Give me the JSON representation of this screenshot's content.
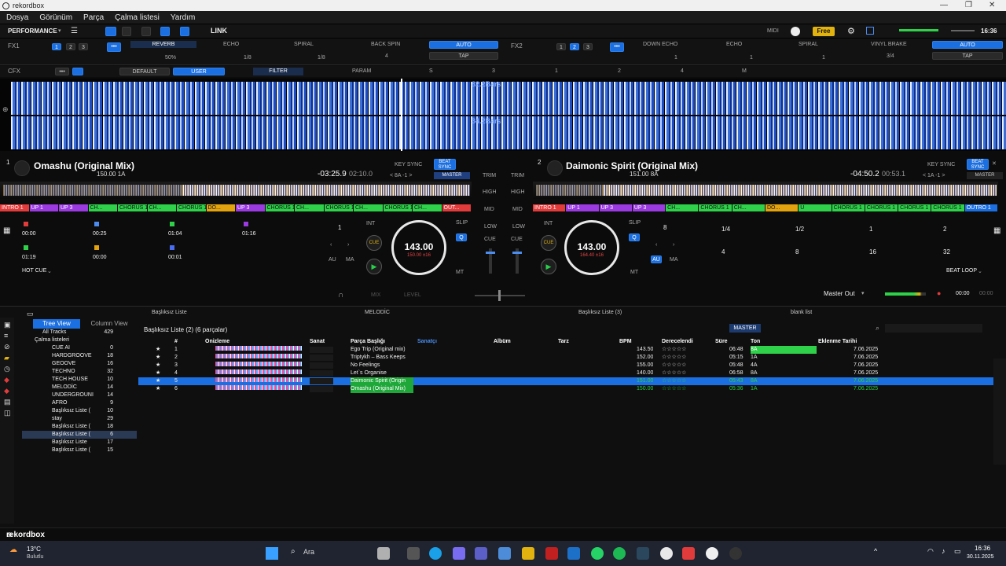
{
  "app": {
    "title": "rekordbox"
  },
  "menu": [
    "Dosya",
    "Görünüm",
    "Parça",
    "Çalma listesi",
    "Yardım"
  ],
  "toolbar": {
    "mode": "PERFORMANCE",
    "link": "LINK",
    "midi": "MIDI",
    "plan": "Free",
    "clock": "16:36"
  },
  "fx1": {
    "label": "FX1",
    "slots": [
      "REVERB",
      "ECHO",
      "SPIRAL"
    ],
    "beat_spin": "BACK SPIN",
    "auto": "AUTO",
    "tap": "TAP",
    "vals": [
      "50%",
      "1/8",
      "1/8",
      "4"
    ]
  },
  "fx2": {
    "label": "FX2",
    "slots": [
      "DOWN ECHO",
      "ECHO",
      "SPIRAL"
    ],
    "beat_fx": "VINYL BRAKE",
    "auto": "AUTO",
    "tap": "TAP",
    "vals": [
      "1",
      "1",
      "1",
      "3/4"
    ]
  },
  "cfx": {
    "label": "CFX",
    "default": "DEFAULT",
    "user": "USER",
    "filter": "FILTER",
    "param": "PARAM",
    "marks": [
      "S",
      "3",
      "1",
      "2",
      "4",
      "M"
    ]
  },
  "waves": {
    "bars1": "82.2Bars",
    "bars2": "34.2Bars"
  },
  "deck1": {
    "num": "1",
    "title": "Omashu (Original Mix)",
    "bpm_key": "150.00 1A",
    "time_remain": "-03:25.9",
    "time_elapsed": "02:10.0",
    "key_sync": "KEY SYNC",
    "beat_sync": "BEAT SYNC",
    "master": "MASTER",
    "key_ctrl": "< 8A -1 >",
    "cues": [
      "INTRO 1",
      "UP 1",
      "UP 3",
      "CH...",
      "CHORUS 1",
      "CH...",
      "CHORUS 1",
      "DO...",
      "UP 3",
      "CHORUS 1",
      "CH...",
      "CHORUS 1",
      "CH...",
      "CHORUS 1",
      "CH...",
      "OUT..."
    ],
    "hotcues": [
      "00:00",
      "00:25",
      "01:04",
      "01:16",
      "01:19",
      "00:00",
      "00:01"
    ],
    "hotcue_mode": "HOT CUE",
    "loop": "1",
    "int": "INT",
    "cue": "CUE",
    "slip": "SLIP",
    "q": "Q",
    "au": "AU",
    "ma": "MA",
    "mt": "MT",
    "jog_bpm": "143.00",
    "jog_sub": "150.00 ±16"
  },
  "deck2": {
    "num": "2",
    "title": "Daimonic Spirit (Original Mix)",
    "bpm_key": "151.00 8A",
    "time_remain": "-04:50.2",
    "time_elapsed": "00:53.1",
    "key_sync": "KEY SYNC",
    "beat_sync": "BEAT SYNC",
    "master": "MASTER",
    "key_ctrl": "< 1A -1 >",
    "cues": [
      "INTRO 1",
      "UP 1",
      "UP 3",
      "UP 3",
      "CH...",
      "CHORUS 1",
      "CH...",
      "DO...",
      "U",
      "CHORUS 1",
      "CHORUS 1",
      "CHORUS 1",
      "CHORUS 1",
      "OUTRO 1"
    ],
    "beatloop": [
      "1/4",
      "1/2",
      "1",
      "2",
      "4",
      "8",
      "16",
      "32"
    ],
    "beatloop_mode": "BEAT LOOP",
    "loop": "8",
    "int": "INT",
    "cue": "CUE",
    "slip": "SLIP",
    "q": "Q",
    "au": "AU",
    "ma": "MA",
    "mt": "MT",
    "jog_bpm": "143.00",
    "jog_sub": "164.40 ±16"
  },
  "mixer": {
    "trim": "TRIM",
    "high": "HIGH",
    "mid": "MID",
    "low": "LOW",
    "cue": "CUE",
    "mix": "MIX",
    "level": "LEVEL",
    "master_out": "Master Out",
    "rec_time": "00:00",
    "rec_total": "00:00"
  },
  "browser": {
    "panes": [
      "Başlıksız Liste",
      "MELODİC",
      "Başlıksız Liste (3)",
      "blank list"
    ],
    "tree_view": "Tree View",
    "column_view": "Column View",
    "list_title": "Başlıksız Liste (2) (6 parçalar)",
    "master_btn": "MASTER",
    "tree": [
      {
        "name": "All Tracks",
        "count": "429"
      },
      {
        "name": "Çalma listeleri",
        "count": ""
      },
      {
        "name": "CUE AI",
        "count": "0"
      },
      {
        "name": "HARDGROOVE",
        "count": "18"
      },
      {
        "name": "GEOOVE",
        "count": "16"
      },
      {
        "name": "TECHNO",
        "count": "32"
      },
      {
        "name": "TECH HOUSE",
        "count": "10"
      },
      {
        "name": "MELODİC",
        "count": "14"
      },
      {
        "name": "UNDERGROUNI",
        "count": "14"
      },
      {
        "name": "AFRO",
        "count": "9"
      },
      {
        "name": "Başlıksız Liste (",
        "count": "10"
      },
      {
        "name": "stay",
        "count": "29"
      },
      {
        "name": "Başlıksız Liste (",
        "count": "18"
      },
      {
        "name": "Başlıksız Liste (",
        "count": "6"
      },
      {
        "name": "Başlıksız Liste",
        "count": "17"
      },
      {
        "name": "Başlıksız Liste (",
        "count": "15"
      }
    ],
    "columns": [
      "#",
      "Önizleme",
      "Sanat",
      "Parça Başlığı",
      "Sanatçı",
      "Albüm",
      "Tarz",
      "BPM",
      "Derecelendi",
      "Süre",
      "Ton",
      "Eklenme Tarihi"
    ],
    "tracks": [
      {
        "no": "1",
        "title": "Ego Trip (Original mix)",
        "bpm": "143.50",
        "time": "06:48",
        "key": "8A",
        "date": "7.06.2025"
      },
      {
        "no": "2",
        "title": "Triptykh – Bass Keeps",
        "bpm": "152.00",
        "time": "05:15",
        "key": "1A",
        "date": "7.06.2025"
      },
      {
        "no": "3",
        "title": "No Feelings",
        "bpm": "155.00",
        "time": "05:48",
        "key": "4A",
        "date": "7.06.2025"
      },
      {
        "no": "4",
        "title": "Let`s Organise",
        "bpm": "140.00",
        "time": "06:58",
        "key": "8A",
        "date": "7.06.2025"
      },
      {
        "no": "5",
        "title": "Daimonic Spirit (Origin",
        "bpm": "151.00",
        "time": "05:43",
        "key": "8A",
        "date": "7.06.2025"
      },
      {
        "no": "6",
        "title": "Omashu (Original Mix)",
        "bpm": "150.00",
        "time": "05:36",
        "key": "1A",
        "date": "7.06.2025"
      }
    ],
    "stars": "☆☆☆☆☆"
  },
  "footer": {
    "brand": "rekordbox"
  },
  "taskbar": {
    "temp": "13°C",
    "weather": "Bulutlu",
    "search": "Ara",
    "time": "16:36",
    "date": "30.11.2025"
  }
}
